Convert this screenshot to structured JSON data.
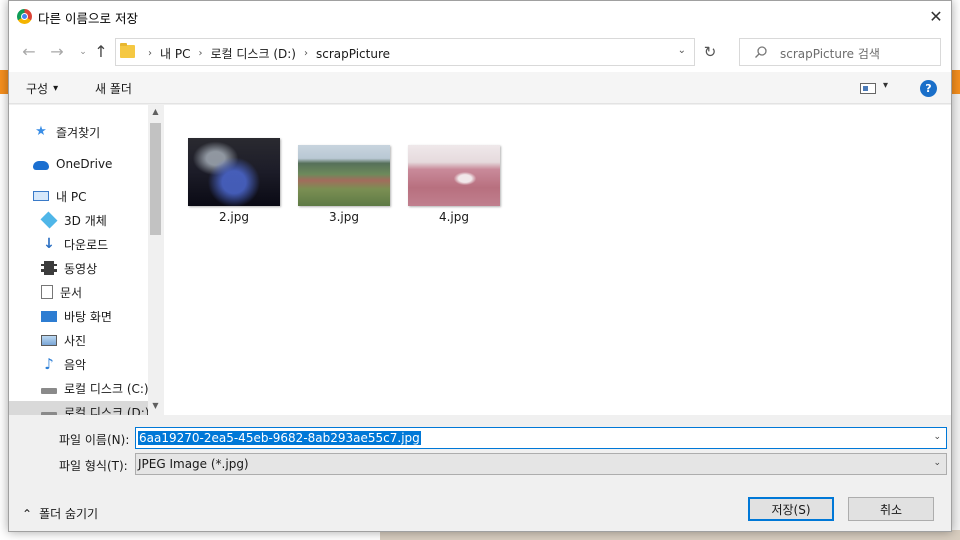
{
  "dialog": {
    "title": "다른 이름으로 저장",
    "close_glyph": "✕"
  },
  "navigation": {
    "back_glyph": "←",
    "forward_glyph": "→",
    "recent_glyph": "⌄",
    "up_glyph": "↑",
    "breadcrumbs": [
      "내 PC",
      "로컬 디스크 (D:)",
      "scrapPicture"
    ],
    "separator": "›",
    "dropdown_glyph": "⌄",
    "refresh_glyph": "↻",
    "search_placeholder": "scrapPicture 검색"
  },
  "toolbar": {
    "organize_label": "구성",
    "organize_arrow": "▾",
    "new_folder_label": "새 폴더",
    "view_dropdown": "▾",
    "help_label": "?"
  },
  "sidebar": {
    "scroll_up": "▲",
    "scroll_down": "▼",
    "items": [
      {
        "label": "즐겨찾기",
        "icon": "star-icon"
      },
      {
        "label": "OneDrive",
        "icon": "cloud-icon"
      },
      {
        "label": "내 PC",
        "icon": "computer-icon"
      },
      {
        "label": "3D 개체",
        "icon": "cube-icon"
      },
      {
        "label": "다운로드",
        "icon": "download-icon"
      },
      {
        "label": "동영상",
        "icon": "video-icon"
      },
      {
        "label": "문서",
        "icon": "document-icon"
      },
      {
        "label": "바탕 화면",
        "icon": "desktop-icon"
      },
      {
        "label": "사진",
        "icon": "photo-icon"
      },
      {
        "label": "음악",
        "icon": "music-icon"
      },
      {
        "label": "로컬 디스크 (C:)",
        "icon": "drive-icon"
      },
      {
        "label": "로컬 디스크 (D:)",
        "icon": "drive-icon"
      }
    ]
  },
  "files": [
    {
      "name": "2.jpg"
    },
    {
      "name": "3.jpg"
    },
    {
      "name": "4.jpg"
    }
  ],
  "form": {
    "filename_label": "파일 이름(N):",
    "filename_value": "6aa19270-2ea5-45eb-9682-8ab293ae55c7.jpg",
    "filetype_label": "파일 형식(T):",
    "filetype_value": "JPEG Image (*.jpg)",
    "dropdown_glyph": "⌄",
    "hide_folders_label": "폴더 숨기기",
    "hide_folders_glyph": "⌃",
    "save_label": "저장(S)",
    "cancel_label": "취소"
  }
}
